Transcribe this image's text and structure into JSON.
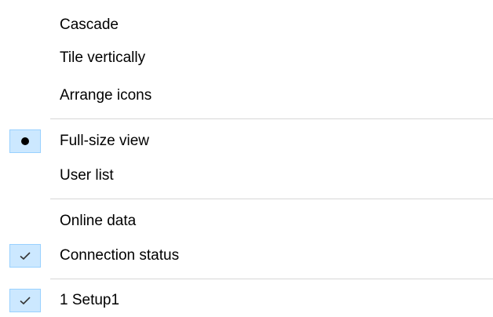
{
  "menu": {
    "items": [
      {
        "label": "Cascade",
        "state": "none"
      },
      {
        "label": "Tile vertically",
        "state": "none"
      },
      {
        "label": "Arrange icons",
        "state": "none"
      },
      {
        "label": "Full-size view",
        "state": "radio-selected"
      },
      {
        "label": "User list",
        "state": "none"
      },
      {
        "label": "Online data",
        "state": "none"
      },
      {
        "label": "Connection status",
        "state": "checked"
      },
      {
        "label": "1 Setup1",
        "state": "checked"
      }
    ],
    "icons": {
      "radio_mark": "bullet-icon",
      "check_mark": "checkmark-icon"
    },
    "colors": {
      "checked_background": "#cce8ff",
      "checked_border": "#99d1ff",
      "separator": "#d7d7d7",
      "text": "#000000",
      "background": "#ffffff"
    }
  }
}
